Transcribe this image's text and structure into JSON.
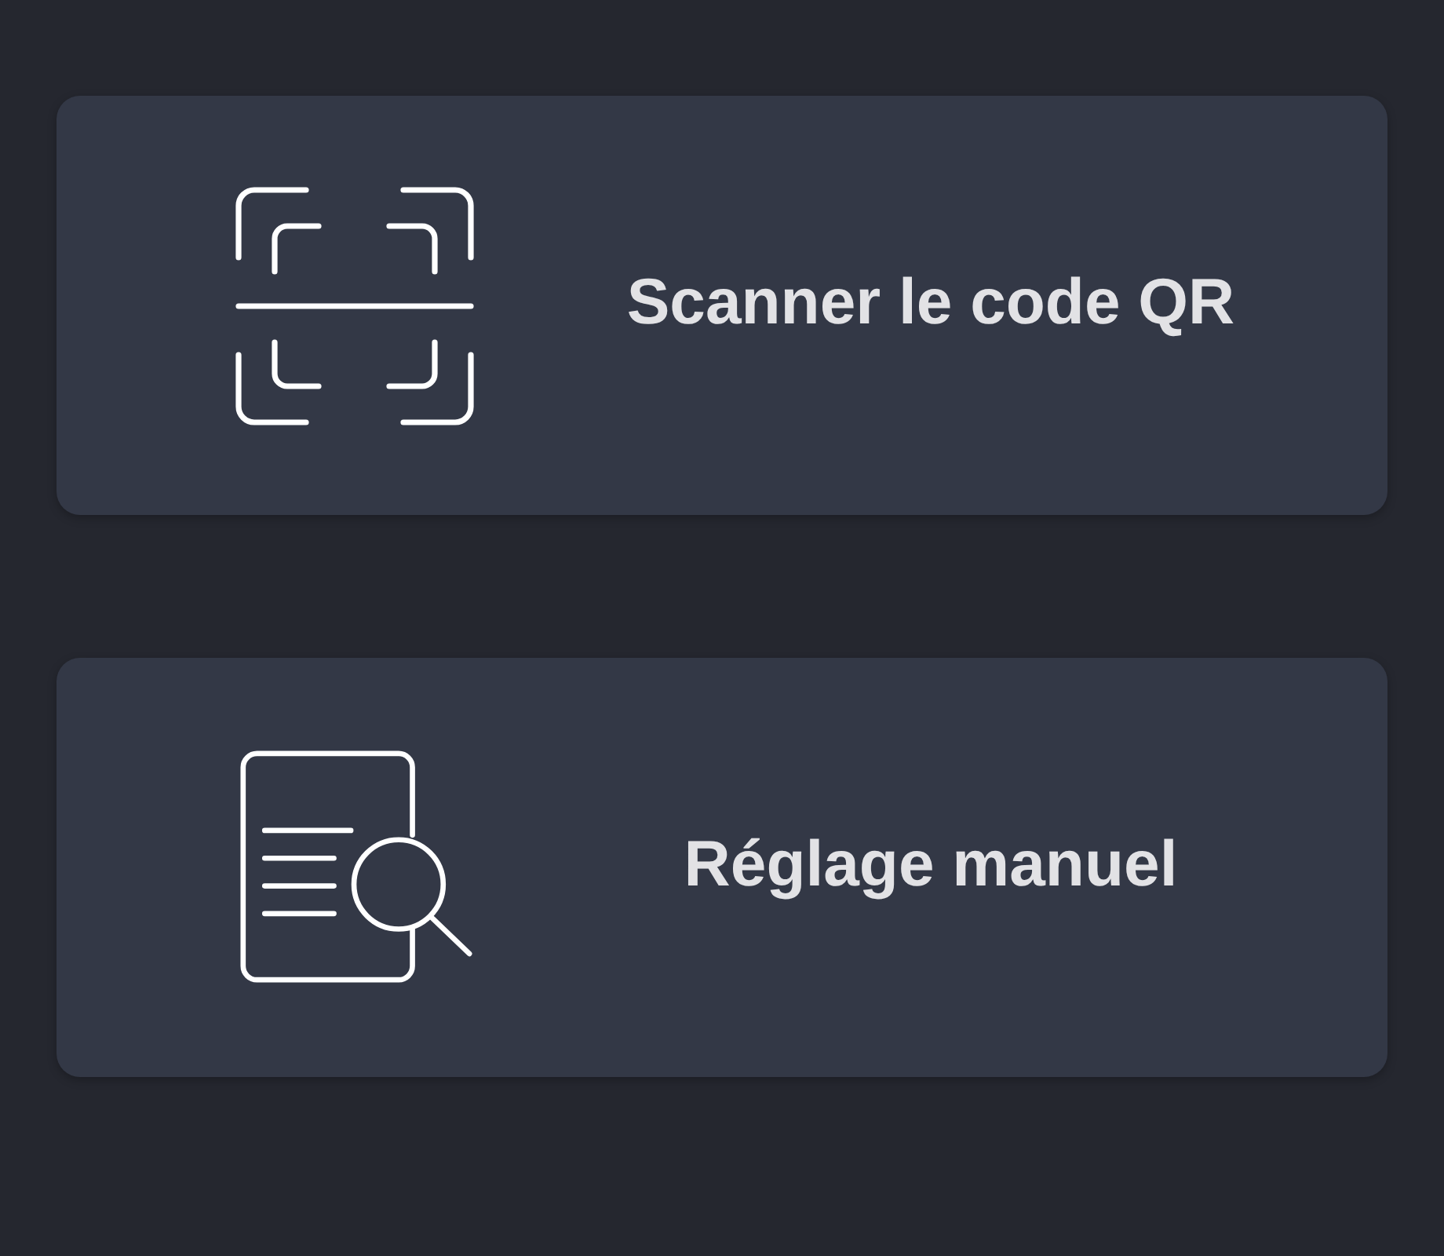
{
  "options": [
    {
      "kind": "qr-scan",
      "label": "Scanner le code QR"
    },
    {
      "kind": "manual",
      "label": "Réglage manuel"
    }
  ]
}
